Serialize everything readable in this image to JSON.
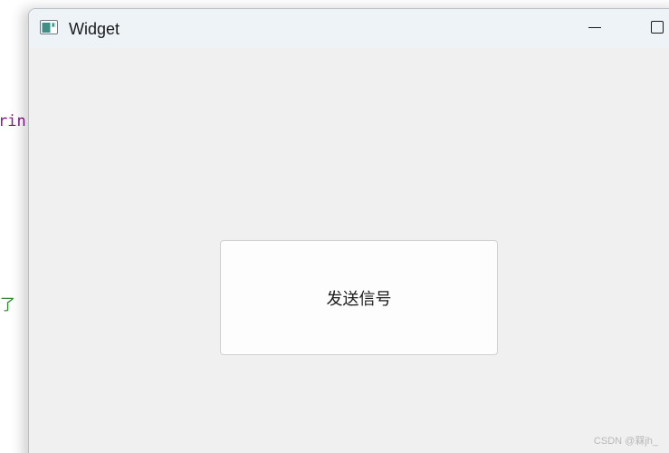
{
  "background_editor": {
    "line1_fragment": "rin",
    "line2_fragment": "了"
  },
  "window": {
    "title": "Widget",
    "icon": "qt-widget-app-icon",
    "controls": {
      "minimize_icon": "minimize-icon",
      "maximize_icon": "maximize-icon"
    }
  },
  "content": {
    "send_button_label": "发送信号"
  },
  "watermark": "CSDN @槑jh_",
  "colors": {
    "titlebar": "#eef3f8",
    "client_bg": "#f0f0f0",
    "button_bg": "#fdfdfd",
    "button_border": "#d0d0d0"
  }
}
